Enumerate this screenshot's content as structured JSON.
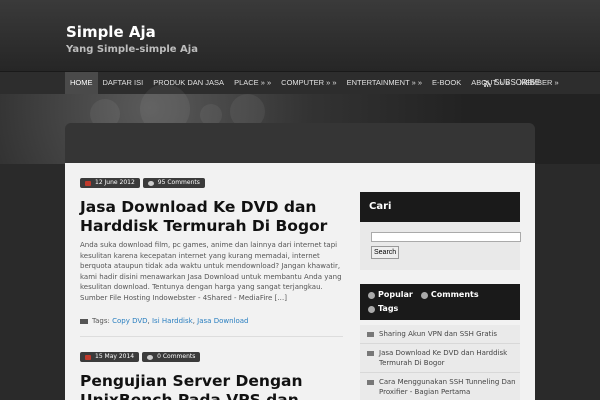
{
  "header": {
    "title": "Simple Aja",
    "tagline": "Yang Simple-simple Aja"
  },
  "nav": {
    "items": [
      {
        "label": "HOME"
      },
      {
        "label": "DAFTAR ISI"
      },
      {
        "label": "PRODUK DAN JASA"
      },
      {
        "label": "PLACE » »"
      },
      {
        "label": "COMPUTER » »"
      },
      {
        "label": "ENTERTAINMENT » »"
      },
      {
        "label": "E-BOOK"
      },
      {
        "label": "ABOUT » »"
      },
      {
        "label": "MEMBER »"
      }
    ],
    "subscribe": "SUBSCRIBE"
  },
  "posts": [
    {
      "date": "12 June 2012",
      "comments": "95 Comments",
      "title": "Jasa Download Ke DVD dan Harddisk Termurah Di Bogor",
      "excerpt": "Anda suka download film, pc games, anime dan lainnya dari internet tapi kesulitan karena kecepatan internet yang kurang memadai, internet berquota ataupun tidak ada waktu untuk mendownload? Jangan khawatir, kami hadir disini menawarkan Jasa Download untuk membantu Anda yang kesulitan download. Tentunya dengan harga yang sangat terjangkau. Sumber File Hosting Indowebster - 4Shared - MediaFire […]",
      "tags_label": "Tags:",
      "tags": [
        "Copy DVD",
        "Isi Harddisk",
        "Jasa Download"
      ]
    },
    {
      "date": "15 May 2014",
      "comments": "0 Comments",
      "title": "Pengujian Server Dengan UnixBench Pada VPS dan"
    }
  ],
  "sidebar": {
    "search_title": "Cari",
    "search_button": "Search",
    "tabs": [
      {
        "label": "Popular"
      },
      {
        "label": "Comments"
      },
      {
        "label": "Tags"
      }
    ],
    "popular": [
      "Sharing Akun VPN dan SSH Gratis",
      "Jasa Download Ke DVD dan Harddisk Termurah Di Bogor",
      "Cara Menggunakan SSH Tunneling Dan Proxifier - Bagian Pertama"
    ]
  },
  "colors": {
    "accent_link": "#2a7fc0",
    "header_bg": "#2a2a2a"
  }
}
